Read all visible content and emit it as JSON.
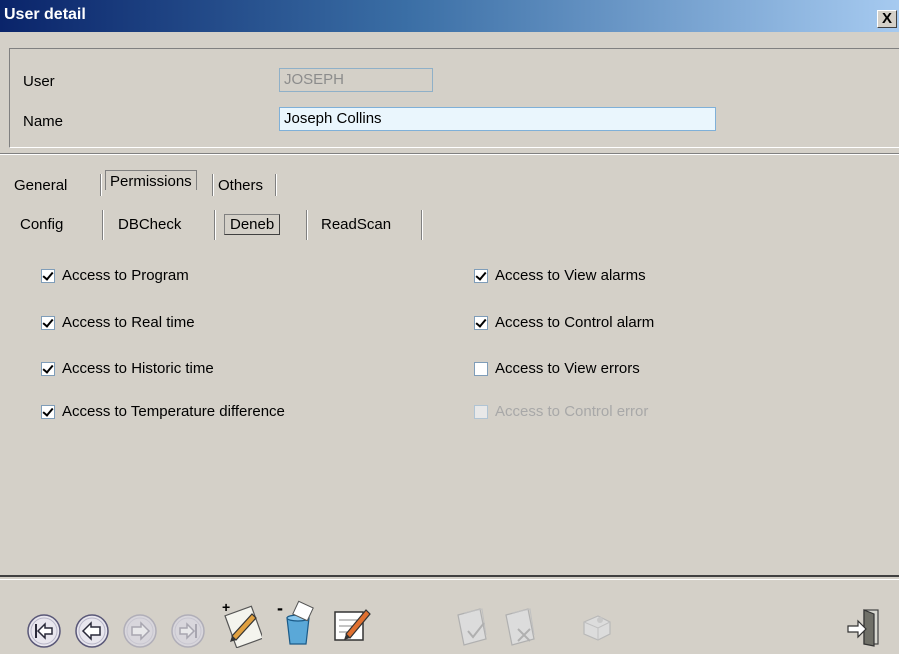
{
  "window": {
    "title": "User detail",
    "close_label": "X"
  },
  "user_panel": {
    "user_label": "User",
    "user_value": "JOSEPH",
    "name_label": "Name",
    "name_value": "Joseph Collins"
  },
  "tabs": [
    "General",
    "Permissions",
    "Others"
  ],
  "subtabs": [
    "Config",
    "DBCheck",
    "Deneb",
    "ReadScan"
  ],
  "permissions_left": [
    {
      "label": "Access to Program",
      "checked": true,
      "enabled": true
    },
    {
      "label": "Access to Real time",
      "checked": true,
      "enabled": true
    },
    {
      "label": "Access to Historic time",
      "checked": true,
      "enabled": true
    },
    {
      "label": "Access to Temperature difference",
      "checked": true,
      "enabled": true
    }
  ],
  "permissions_right": [
    {
      "label": "Access to View alarms",
      "checked": true,
      "enabled": true
    },
    {
      "label": "Access to Control alarm",
      "checked": true,
      "enabled": true
    },
    {
      "label": "Access to View errors",
      "checked": false,
      "enabled": true
    },
    {
      "label": "Access to Control error",
      "checked": false,
      "enabled": false
    }
  ],
  "toolbar": {
    "icons": [
      "first-record-icon",
      "previous-record-icon",
      "next-record-icon",
      "last-record-icon",
      "new-record-icon",
      "delete-record-icon",
      "edit-record-icon",
      "confirm-icon",
      "cancel-icon",
      "refresh-icon",
      "exit-icon"
    ]
  }
}
